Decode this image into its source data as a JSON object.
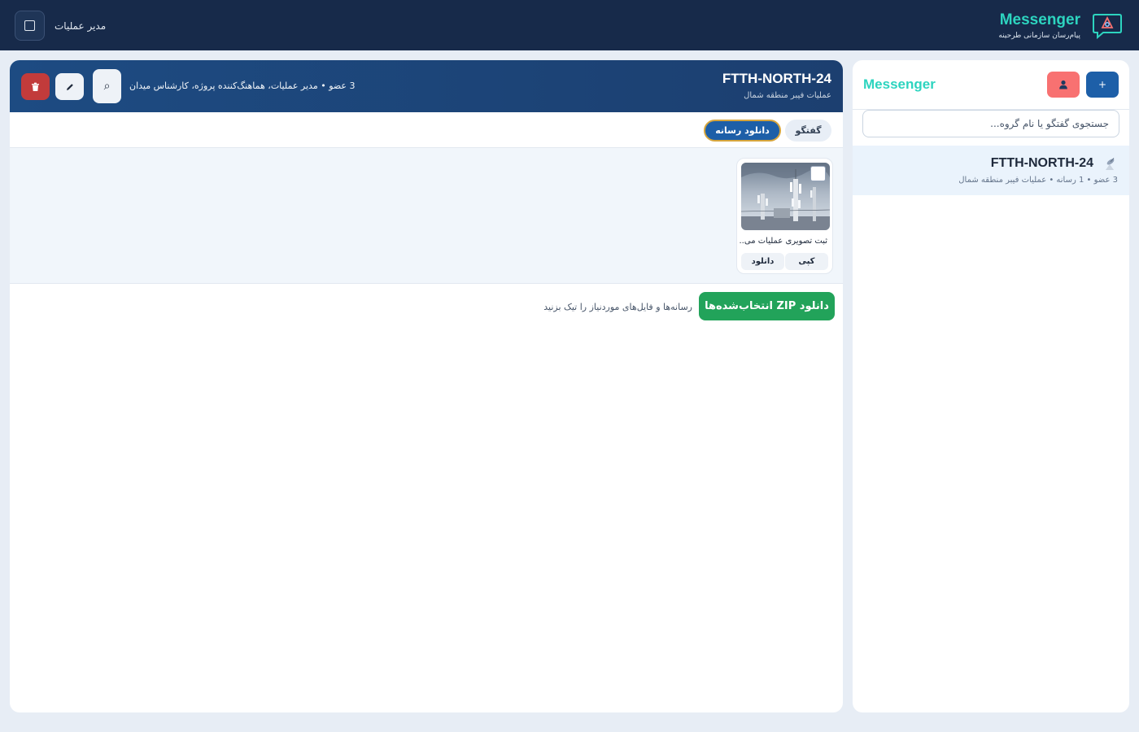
{
  "topbar": {
    "brand_title": "Messenger",
    "brand_subtitle": "پیام‌رسان سازمانی طرحینه",
    "user_name": "مدیر عملیات",
    "logo_icon": "chat-bubble-logo-icon",
    "menu_icon": "square-icon"
  },
  "sidebar": {
    "title": "Messenger",
    "add_button_label": "+",
    "user_button_icon": "user-icon",
    "search_placeholder": "جستجوی گفتگو یا نام گروه...",
    "conversations": [
      {
        "icon": "satellite-icon",
        "name": "FTTH-NORTH-24",
        "meta": "3 عضو • 1 رسانه • عملیات فیبر منطقه شمال"
      }
    ]
  },
  "chat": {
    "title": "FTTH-NORTH-24",
    "subtitle": "عملیات فیبر منطقه شمال",
    "members": "3 عضو • مدیر عملیات، هماهنگ‌کننده پروژه، کارشناس میدان",
    "search_icon": "⌕",
    "tabs": [
      {
        "label": "گفتگو",
        "active": false
      },
      {
        "label": "دانلود رسانه",
        "active": true
      }
    ],
    "media": [
      {
        "caption": "ثبت تصویری عملیات می...",
        "copy_label": "کپی",
        "download_label": "دانلود"
      }
    ],
    "zip_button_label": "دانلود ZIP انتخاب‌شده‌ها",
    "zip_hint": "رسانه‌ها و فایل‌های موردنیاز را تیک بزنید"
  },
  "colors": {
    "topbar": "#172a4a",
    "brand_accent": "#2dd4bf",
    "primary": "#1d5fa8",
    "danger": "#c23b3b",
    "success": "#22a35a"
  }
}
